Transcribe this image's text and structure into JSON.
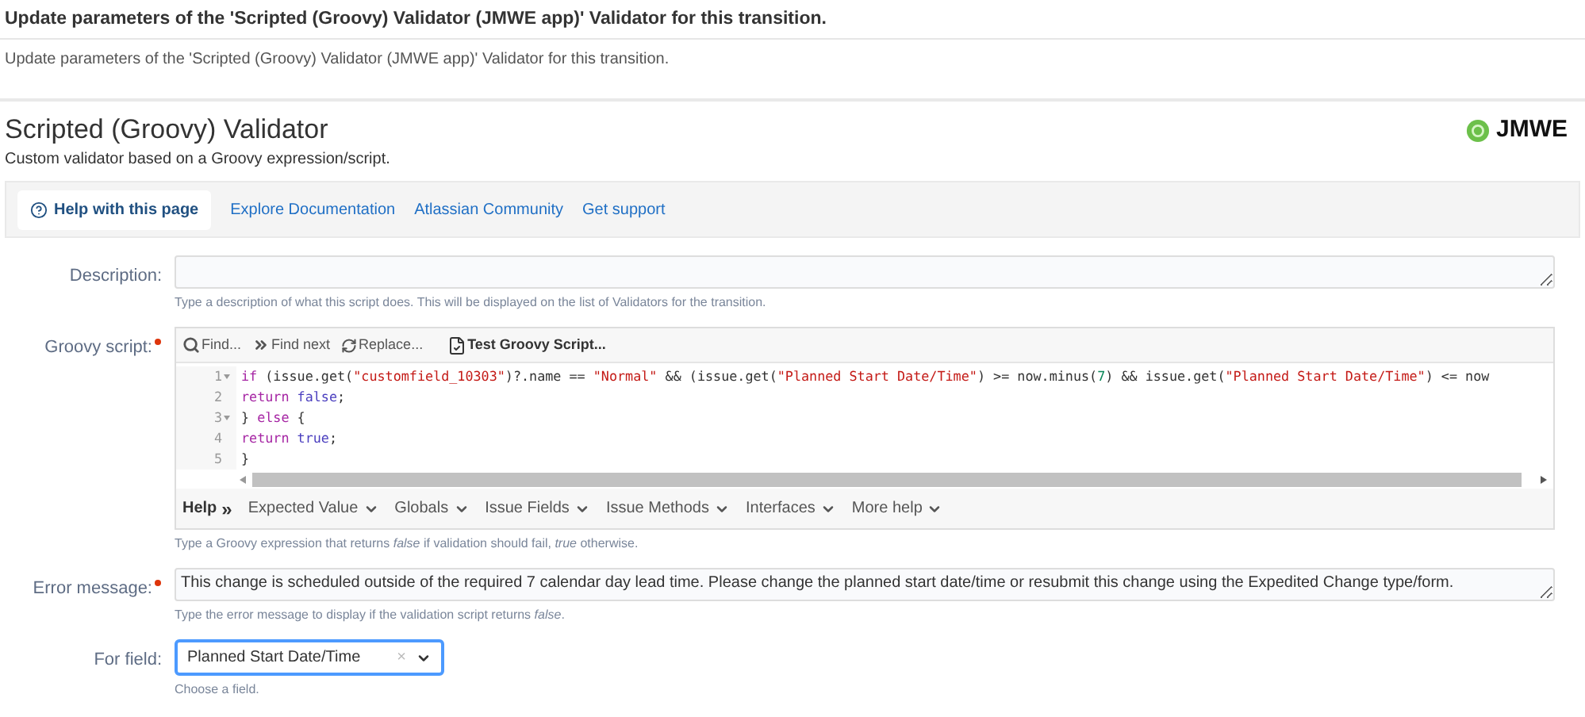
{
  "dialog_title": "Update parameters of the 'Scripted (Groovy) Validator (JMWE app)' Validator for this transition.",
  "intro": "Update parameters of the 'Scripted (Groovy) Validator (JMWE app)' Validator for this transition.",
  "heading": {
    "title": "Scripted (Groovy) Validator",
    "subtitle": "Custom validator based on a Groovy expression/script.",
    "logo": "JMWE"
  },
  "help_bar": [
    {
      "label": "Help with this page",
      "selected": true
    },
    {
      "label": "Explore Documentation",
      "selected": false
    },
    {
      "label": "Atlassian Community",
      "selected": false
    },
    {
      "label": "Get support",
      "selected": false
    }
  ],
  "description": {
    "label": "Description:",
    "required": false,
    "hint": "Type a description of what this script does. This will be displayed on the list of Validators for the transition."
  },
  "script": {
    "label": "Groovy script:",
    "required": true,
    "toolbar": [
      {
        "label": "Find...",
        "kind": "search"
      },
      {
        "label": "Find next",
        "kind": "next"
      },
      {
        "label": "Replace...",
        "kind": "replace"
      },
      {
        "label": "Test Groovy Script...",
        "kind": "test"
      }
    ],
    "lines": [
      {
        "number": "1",
        "foldable": true,
        "tokens": [
          {
            "kind": "keyword",
            "text": "if"
          },
          {
            "kind": "plain",
            "text": " (issue.get("
          },
          {
            "kind": "string",
            "text": "\"customfield_10303\""
          },
          {
            "kind": "plain",
            "text": ")?.name == "
          },
          {
            "kind": "string",
            "text": "\"Normal\""
          },
          {
            "kind": "plain",
            "text": " && (issue.get("
          },
          {
            "kind": "string",
            "text": "\"Planned Start Date/Time\""
          },
          {
            "kind": "plain",
            "text": ") >= now.minus("
          },
          {
            "kind": "number",
            "text": "7"
          },
          {
            "kind": "plain",
            "text": ") && issue.get("
          },
          {
            "kind": "string",
            "text": "\"Planned Start Date/Time\""
          },
          {
            "kind": "plain",
            "text": ") <= now"
          }
        ]
      },
      {
        "number": "2",
        "foldable": false,
        "tokens": [
          {
            "kind": "keyword",
            "text": "return"
          },
          {
            "kind": "literal",
            "text": " false"
          },
          {
            "kind": "plain",
            "text": ";"
          }
        ]
      },
      {
        "number": "3",
        "foldable": true,
        "tokens": [
          {
            "kind": "plain",
            "text": "} "
          },
          {
            "kind": "keyword",
            "text": "else"
          },
          {
            "kind": "plain",
            "text": " {"
          }
        ]
      },
      {
        "number": "4",
        "foldable": false,
        "tokens": [
          {
            "kind": "keyword",
            "text": "return"
          },
          {
            "kind": "literal",
            "text": " true"
          },
          {
            "kind": "plain",
            "text": ";"
          }
        ]
      },
      {
        "number": "5",
        "foldable": false,
        "tokens": [
          {
            "kind": "plain",
            "text": "}"
          }
        ]
      }
    ],
    "help_label": "Help",
    "help_arrow": "»",
    "help_menus": [
      "Expected Value",
      "Globals",
      "Issue Fields",
      "Issue Methods",
      "Interfaces",
      "More help"
    ],
    "hint": "Type a Groovy expression that returns *false* if validation should fail, *true* otherwise."
  },
  "error_message": {
    "label": "Error message:",
    "required": true,
    "value": "This change is scheduled outside of the required 7 calendar day lead time. Please change the planned start date/time or resubmit this change using the Expedited Change type/form.",
    "hint": "Type the error message to display if the validation script returns *false*."
  },
  "for_field": {
    "label": "For field:",
    "required": false,
    "value": "Planned Start Date/Time",
    "clear": "×",
    "hint": "Choose a field."
  }
}
